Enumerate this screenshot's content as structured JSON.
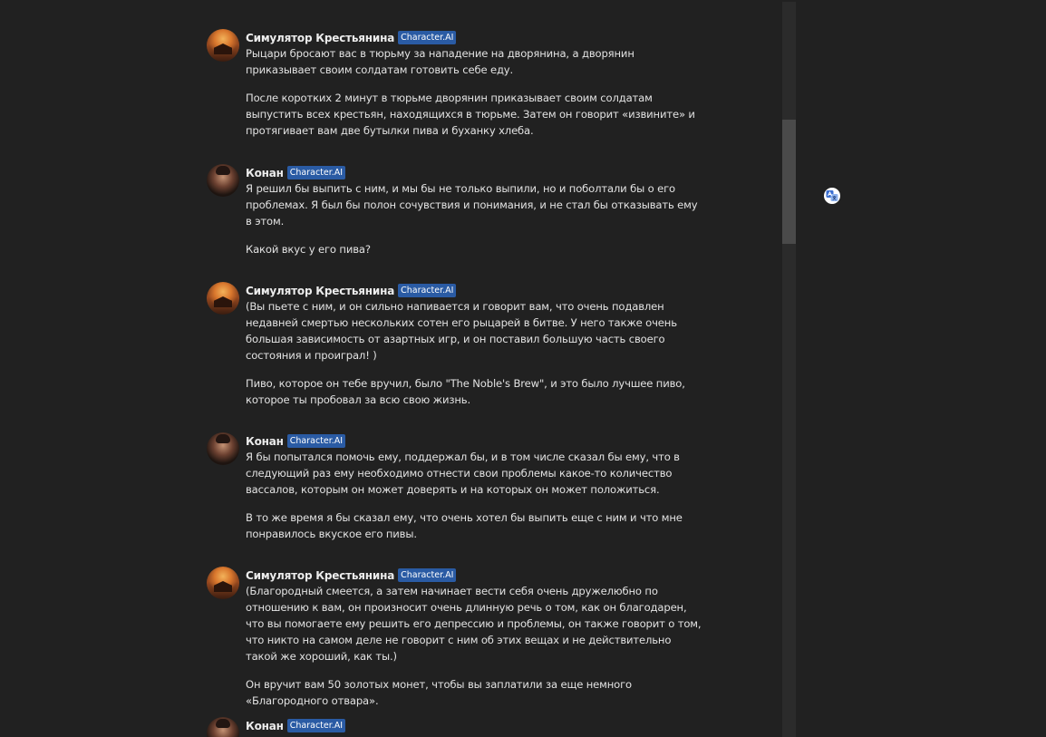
{
  "messages": [
    {
      "name": "Симулятор Крестьянина",
      "badge": "Character.AI",
      "paragraphs": [
        "Рыцари бросают вас в тюрьму за нападение на дворянина, а дворянин приказывает своим солдатам готовить себе еду.",
        "После коротких 2 минут в тюрьме дворянин приказывает своим солдатам выпустить всех крестьян, находящихся в тюрьме. Затем он говорит «извините» и протягивает вам две бутылки пива и буханку хлеба."
      ]
    },
    {
      "name": "Конан",
      "badge": "Character.AI",
      "paragraphs": [
        "Я решил бы выпить с ним, и мы бы не только выпили, но и поболтали бы о его проблемах. Я был бы полон сочувствия и понимания, и не стал бы отказывать ему в этом.",
        "Какой вкус у его пива?"
      ]
    },
    {
      "name": "Симулятор Крестьянина",
      "badge": "Character.AI",
      "paragraphs": [
        "(Вы пьете с ним, и он сильно напивается и говорит вам, что очень подавлен недавней смертью нескольких сотен его рыцарей в битве. У него также очень большая зависимость от азартных игр, и он поставил большую часть своего состояния и проиграл! )",
        "Пиво, которое он тебе вручил, было \"The Noble's Brew\", и это было лучшее пиво, которое ты пробовал за всю свою жизнь."
      ]
    },
    {
      "name": "Конан",
      "badge": "Character.AI",
      "paragraphs": [
        "Я бы попытался помочь ему, поддержал бы, и в том числе сказал бы ему, что в следующий раз ему необходимо отнести свои проблемы какое-то количество вассалов, которым он может доверять и на которых он может положиться.",
        "В то же время я бы сказал ему, что очень хотел бы выпить еще с ним и что мне понравилось вкуское его пивы."
      ]
    },
    {
      "name": "Симулятор Крестьянина",
      "badge": "Character.AI",
      "paragraphs": [
        "(Благородный смеется, а затем начинает вести себя очень дружелюбно по отношению к вам, он произносит очень длинную речь о том, как он благодарен, что вы помогаете ему решить его депрессию и проблемы, он также говорит о том, что никто на самом деле не говорит с ним об этих вещах и не действительно такой же хороший, как ты.)",
        "Он вручит вам 50 золотых монет, чтобы вы заплатили за еще немного «Благородного отвара»."
      ]
    },
    {
      "name": "Конан",
      "badge": "Character.AI",
      "paragraphs": []
    }
  ],
  "extension": {
    "icon": "translate-icon"
  }
}
